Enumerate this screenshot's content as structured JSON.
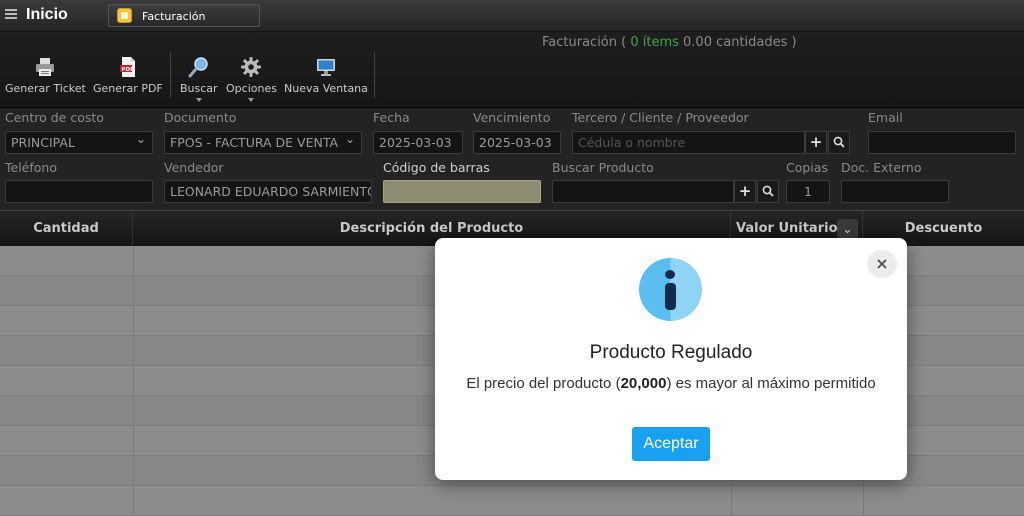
{
  "topbar": {
    "title": "Inicio",
    "tab_label": "Facturación"
  },
  "toolbar": {
    "summary_prefix": "Facturación ( ",
    "summary_items": "0 ítems",
    "summary_suffix": "  0.00 cantidades )",
    "buttons": {
      "ticket": "Generar Ticket",
      "pdf": "Generar PDF",
      "search": "Buscar",
      "options": "Opciones",
      "new_window": "Nueva Ventana"
    }
  },
  "form": {
    "cost_center": {
      "label": "Centro de costo",
      "value": "PRINCIPAL"
    },
    "document": {
      "label": "Documento",
      "value": "FPOS - FACTURA DE VENTA"
    },
    "date": {
      "label": "Fecha",
      "value": "2025-03-03"
    },
    "due": {
      "label": "Vencimiento",
      "value": "2025-03-03"
    },
    "third_party": {
      "label": "Tercero / Cliente / Proveedor",
      "placeholder": "Cédula o nombre"
    },
    "email": {
      "label": "Email",
      "value": ""
    },
    "phone": {
      "label": "Teléfono",
      "value": ""
    },
    "seller": {
      "label": "Vendedor",
      "value": "LEONARD EDUARDO SARMIENTO"
    },
    "barcode": {
      "label": "Código de barras",
      "value": ""
    },
    "product_search": {
      "label": "Buscar Producto",
      "value": ""
    },
    "copies": {
      "label": "Copias",
      "value": "1"
    },
    "external_doc": {
      "label": "Doc. Externo",
      "value": ""
    }
  },
  "grid": {
    "columns": {
      "quantity": "Cantidad",
      "description": "Descripción del Producto",
      "unit_value": "Valor Unitario",
      "discount": "Descuento"
    }
  },
  "modal": {
    "title": "Producto Regulado",
    "message_prefix": "El precio del producto (",
    "message_value": "20,000",
    "message_suffix": ") es mayor al máximo permitido",
    "accept": "Aceptar",
    "close": "×"
  },
  "icons": {
    "plus": "+",
    "magnifier": "search-icon"
  }
}
